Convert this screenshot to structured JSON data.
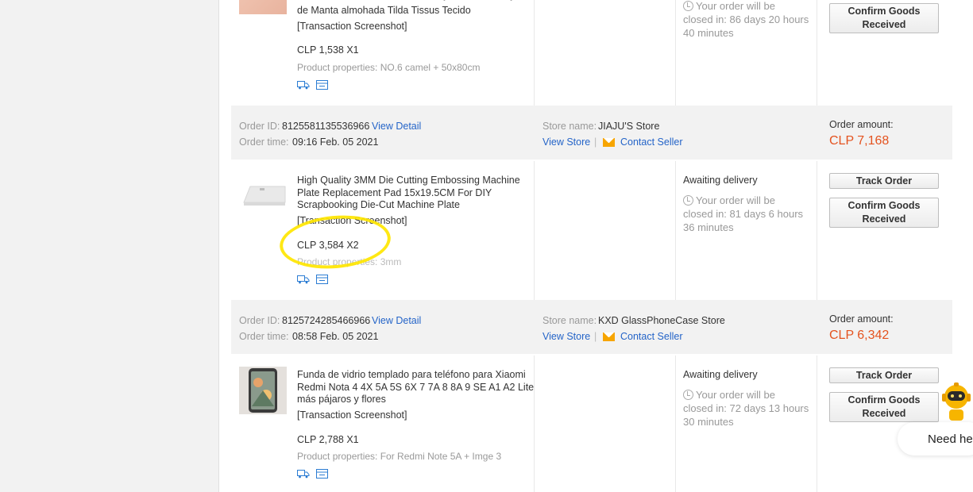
{
  "colors": {
    "amount": "#e4531f",
    "link": "#2464c8",
    "highlight": "#ffe600",
    "mail": "#f7a500"
  },
  "labels": {
    "order_id": "Order ID:",
    "order_time": "Order time:",
    "store_name": "Store name:",
    "order_amount": "Order amount:",
    "view_detail": "View Detail",
    "view_store": "View Store",
    "contact_seller": "Contact Seller",
    "separator": "|",
    "transaction_screenshot": "[Transaction Screenshot]",
    "awaiting_delivery": "Awaiting delivery",
    "track_order": "Track Order",
    "confirm_goods": "Confirm Goods\nReceived"
  },
  "top_item": {
    "title_line1": "de Manta almohada Tilda Tissus Tecido",
    "price": "CLP 1,538 X1",
    "props": "Product properties: NO.6 camel + 50x80cm",
    "status": [
      "Your order will be",
      "closed in: 86 days 20 hours",
      "40 minutes"
    ]
  },
  "orders": [
    {
      "id": "8125581135536966",
      "time": "09:16 Feb. 05 2021",
      "store": "JIAJU'S Store",
      "amount": "CLP 7,168",
      "item": {
        "title": "High Quality 3MM Die Cutting Embossing Machine Plate Replacement Pad 15x19.5CM For DIY Scrapbooking Die-Cut Machine Plate",
        "price": "CLP 3,584 X2",
        "props": "Product properties: 3mm",
        "status": [
          "Your order will be",
          "closed in: 81 days 6 hours",
          "36 minutes"
        ]
      }
    },
    {
      "id": "8125724285466966",
      "time": "08:58 Feb. 05 2021",
      "store": "KXD GlassPhoneCase Store",
      "amount": "CLP 6,342",
      "item": {
        "title": "Funda de vidrio templado para teléfono para Xiaomi Redmi Nota 4 4X 5A 5S 6X 7 7A 8 8A 9 SE A1 A2 Lite más pájaros y flores",
        "price": "CLP 2,788 X1",
        "props": "Product properties: For Redmi Note 5A + Imge 3",
        "status": [
          "Your order will be",
          "closed in: 72 days 13 hours",
          "30 minutes"
        ]
      }
    }
  ],
  "chat": {
    "text": "Need he"
  }
}
